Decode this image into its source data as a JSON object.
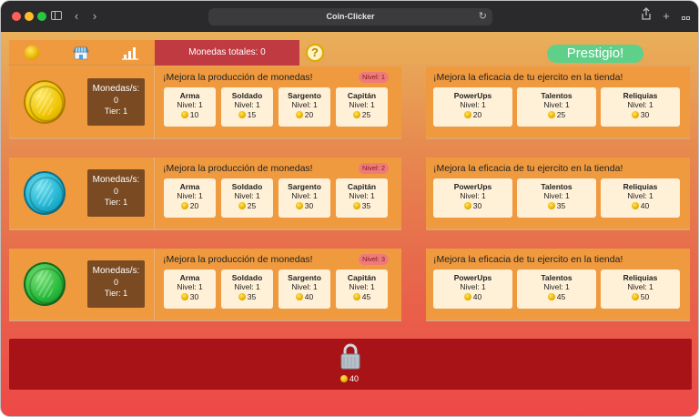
{
  "browser": {
    "url_title": "Coin-Clicker"
  },
  "header": {
    "total_coins": "Monedas totales: 0",
    "help": "?",
    "prestige": "Prestigio!"
  },
  "rows": [
    {
      "coin_color": "gold",
      "rate_label": "Monedas/s:",
      "rate_value": "0",
      "tier": "Tier: 1",
      "prod_title": "¡Mejora la producción de monedas!",
      "level_badge": "Nivel: 1",
      "upgrades": [
        {
          "name": "Arma",
          "level": "Nivel: 1",
          "cost": "10"
        },
        {
          "name": "Soldado",
          "level": "Nivel: 1",
          "cost": "15"
        },
        {
          "name": "Sargento",
          "level": "Nivel: 1",
          "cost": "20"
        },
        {
          "name": "Capitán",
          "level": "Nivel: 1",
          "cost": "25"
        }
      ],
      "army_title": "¡Mejora la eficacia de tu ejercito en la tienda!",
      "army": [
        {
          "name": "PowerUps",
          "level": "Nivel: 1",
          "cost": "20"
        },
        {
          "name": "Talentos",
          "level": "Nivel: 1",
          "cost": "25"
        },
        {
          "name": "Reliquias",
          "level": "Nivel: 1",
          "cost": "30"
        }
      ]
    },
    {
      "coin_color": "blue",
      "rate_label": "Monedas/s:",
      "rate_value": "0",
      "tier": "Tier: 1",
      "prod_title": "¡Mejora la producción de monedas!",
      "level_badge": "Nivel: 2",
      "upgrades": [
        {
          "name": "Arma",
          "level": "Nivel: 1",
          "cost": "20"
        },
        {
          "name": "Soldado",
          "level": "Nivel: 1",
          "cost": "25"
        },
        {
          "name": "Sargento",
          "level": "Nivel: 1",
          "cost": "30"
        },
        {
          "name": "Capitán",
          "level": "Nivel: 1",
          "cost": "35"
        }
      ],
      "army_title": "¡Mejora la eficacia de tu ejercito en la tienda!",
      "army": [
        {
          "name": "PowerUps",
          "level": "Nivel: 1",
          "cost": "30"
        },
        {
          "name": "Talentos",
          "level": "Nivel: 1",
          "cost": "35"
        },
        {
          "name": "Reliquias",
          "level": "Nivel: 1",
          "cost": "40"
        }
      ]
    },
    {
      "coin_color": "green",
      "rate_label": "Monedas/s:",
      "rate_value": "0",
      "tier": "Tier: 1",
      "prod_title": "¡Mejora la producción de monedas!",
      "level_badge": "Nivel: 3",
      "upgrades": [
        {
          "name": "Arma",
          "level": "Nivel: 1",
          "cost": "30"
        },
        {
          "name": "Soldado",
          "level": "Nivel: 1",
          "cost": "35"
        },
        {
          "name": "Sargento",
          "level": "Nivel: 1",
          "cost": "40"
        },
        {
          "name": "Capitán",
          "level": "Nivel: 1",
          "cost": "45"
        }
      ],
      "army_title": "¡Mejora la eficacia de tu ejercito en la tienda!",
      "army": [
        {
          "name": "PowerUps",
          "level": "Nivel: 1",
          "cost": "40"
        },
        {
          "name": "Talentos",
          "level": "Nivel: 1",
          "cost": "45"
        },
        {
          "name": "Reliquias",
          "level": "Nivel: 1",
          "cost": "50"
        }
      ]
    }
  ],
  "locked_tier": {
    "cost": "40"
  },
  "icons": [
    "coin-icon",
    "shop-icon",
    "stats-icon",
    "help-icon",
    "lock-icon",
    "share-icon",
    "new-tab-icon",
    "tab-overview-icon",
    "sidebar-icon",
    "back-icon",
    "forward-icon",
    "reload-icon"
  ],
  "colors": {
    "accent_red": "#bf3a41",
    "prestige_green": "#5fd08a",
    "card_orange": "#f09a3f",
    "locked_red": "#a81317"
  }
}
